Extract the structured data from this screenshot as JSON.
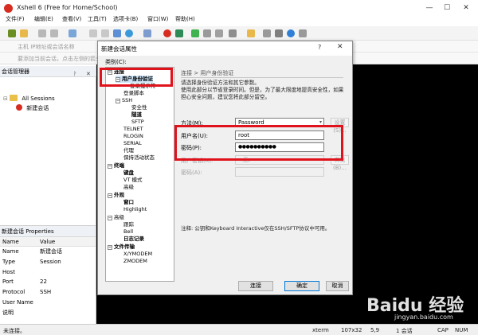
{
  "window": {
    "title": "Xshell 6 (Free for Home/School)",
    "minimize": "—",
    "maximize": "☐",
    "close": "✕"
  },
  "menu": [
    "文件(F)",
    "编辑(E)",
    "查看(V)",
    "工具(T)",
    "选项卡(B)",
    "窗口(W)",
    "帮助(H)"
  ],
  "address_placeholder": "主机 IP地址或会话名称",
  "hint_text": "要添加当前会话，点击左侧的箭头按钮。",
  "session_manager": {
    "title": "会话管理器",
    "root": "All Sessions",
    "child": "新建会话"
  },
  "properties": {
    "title": "新建会话 Properties",
    "col_name": "Name",
    "col_value": "Value",
    "rows": [
      {
        "k": "Name",
        "v": "新建会话"
      },
      {
        "k": "Type",
        "v": "Session"
      },
      {
        "k": "Host",
        "v": ""
      },
      {
        "k": "Port",
        "v": "22"
      },
      {
        "k": "Protocol",
        "v": "SSH"
      },
      {
        "k": "User Name",
        "v": ""
      },
      {
        "k": "说明",
        "v": ""
      }
    ]
  },
  "dialog": {
    "title": "新建会话属性",
    "help": "?",
    "close": "✕",
    "category_label": "类别(C):",
    "breadcrumb": "连接 > 用户身份验证",
    "description": "请选择身份验证方法和其它参数。\n使用此部分以节省登录时间。但是，为了最大限度地提高安全性，如果担心安全问题，建议您将此部分留空。",
    "method_label": "方法(M):",
    "method_value": "Password",
    "settings_btn": "设置(S)...",
    "user_label": "用户名(U):",
    "user_value": "root",
    "pass_label": "密码(P):",
    "pass_value": "●●●●●●●●●●",
    "key_label": "用户密钥(K):",
    "key_value": "<无>",
    "browse_btn": "浏览(B)...",
    "passphrase_label": "密码(A):",
    "note": "注释: 公钥和Keyboard Interactive仅在SSH/SFTP协议中可用。",
    "buttons": {
      "connect": "连接",
      "ok": "确定",
      "cancel": "取消"
    },
    "tree": {
      "connection": "连接",
      "user_auth": "用户身份验证",
      "login_prompts": "登录提示符",
      "login_scripts": "登录脚本",
      "ssh": "SSH",
      "security": "安全性",
      "tunneling": "隧道",
      "sftp": "SFTP",
      "telnet": "TELNET",
      "rlogin": "RLOGIN",
      "serial": "SERIAL",
      "proxy": "代理",
      "keep_alive": "保持活动状态",
      "terminal": "终端",
      "keyboard": "键盘",
      "vt_modes": "VT 模式",
      "advanced": "高级",
      "appearance": "外观",
      "window": "窗口",
      "highlight": "Highlight",
      "advanced2": "高级",
      "trace": "跟踪",
      "bell": "Bell",
      "logging": "日志记录",
      "file_transfer": "文件传输",
      "xymodem": "X/YMODEM",
      "zmodem": "ZMODEM"
    }
  },
  "status": {
    "left": "未连接。",
    "term": "xterm",
    "size": "107x32",
    "pos": "5,9",
    "sessions": "1 会话",
    "cap": "CAP",
    "num": "NUM"
  },
  "watermark": {
    "brand": "Baidu 经验",
    "url": "jingyan.baidu.com"
  },
  "colors": {
    "highlight_red": "#e0121c",
    "selection_blue": "#cce4f7"
  }
}
